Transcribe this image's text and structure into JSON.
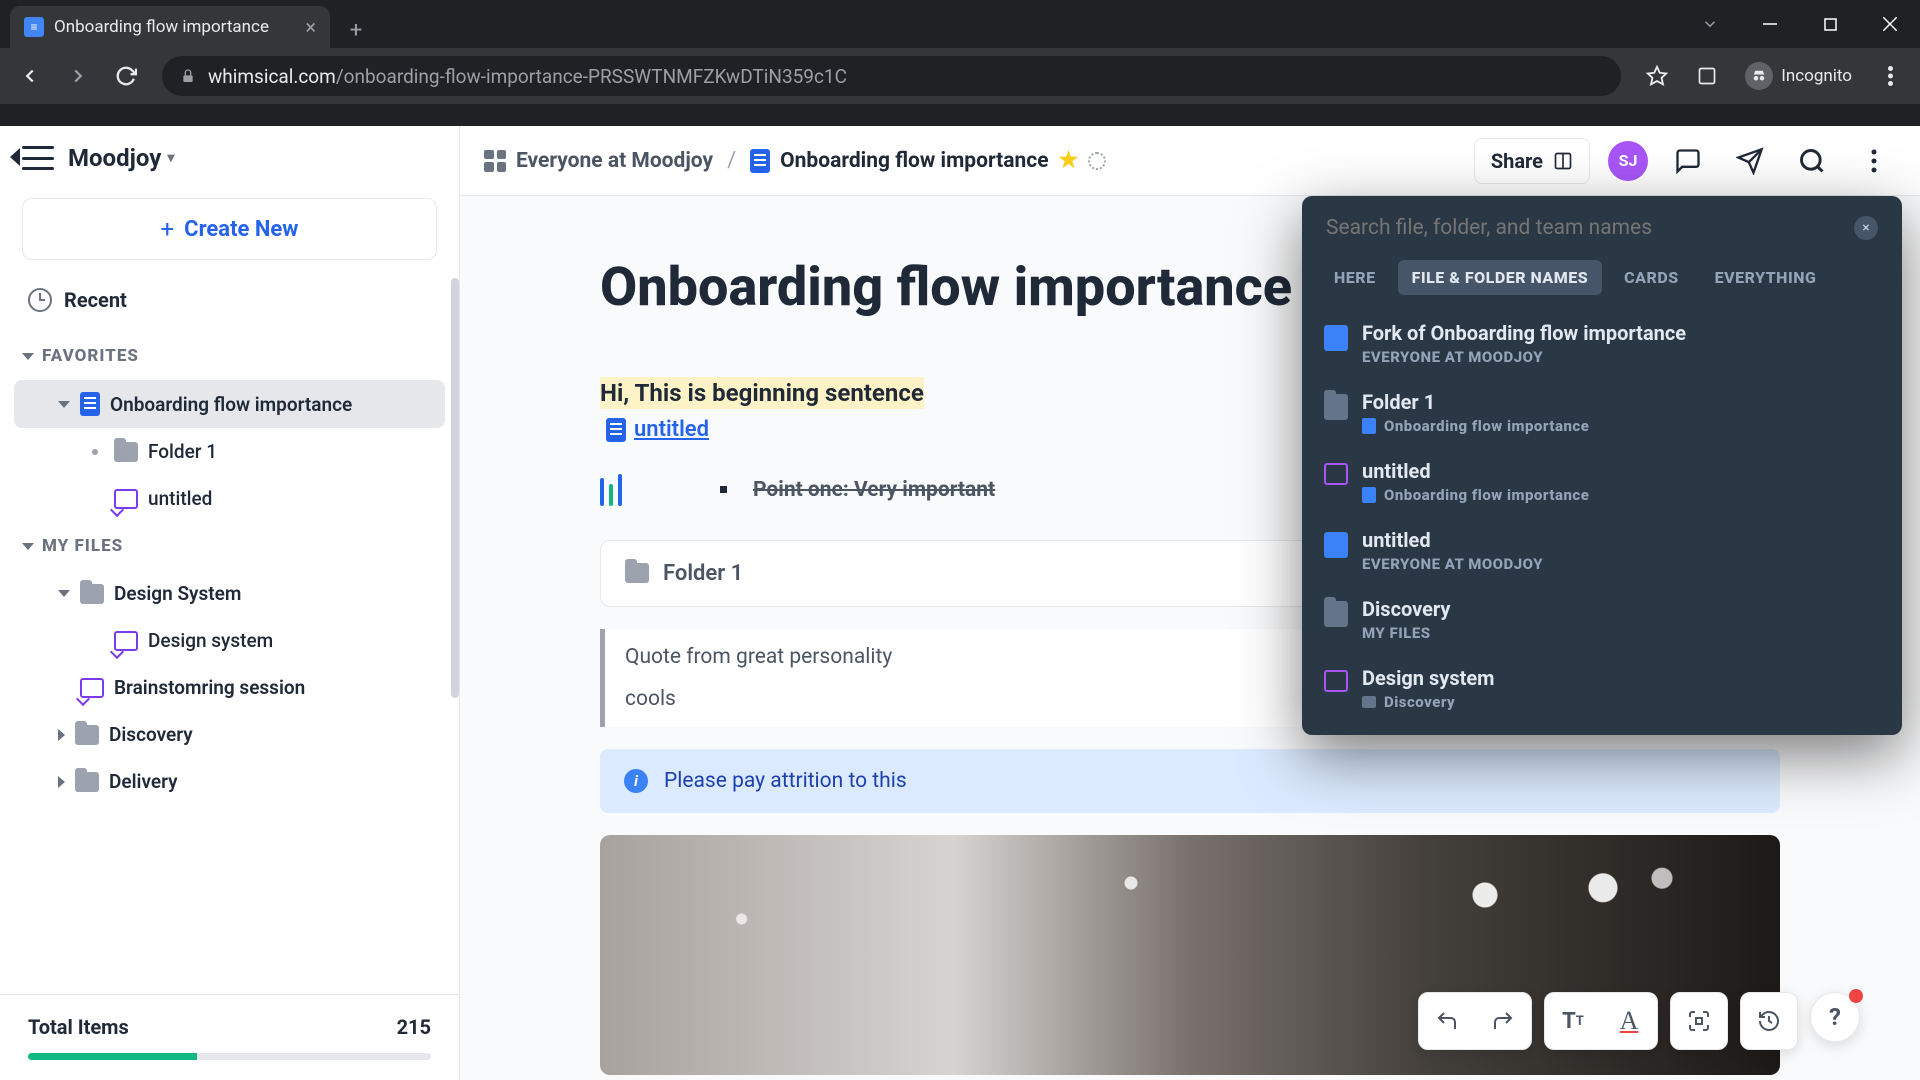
{
  "browser": {
    "tab_title": "Onboarding flow importance",
    "url_domain": "whimsical.com",
    "url_path": "/onboarding-flow-importance-PRSSWTNMFZKwDTiN359c1C",
    "incognito_label": "Incognito"
  },
  "workspace": {
    "name": "Moodjoy"
  },
  "sidebar": {
    "create_label": "Create New",
    "recent_label": "Recent",
    "favorites_label": "FAVORITES",
    "myfiles_label": "MY FILES",
    "fav_items": [
      {
        "label": "Onboarding flow importance"
      },
      {
        "label": "Folder 1"
      },
      {
        "label": "untitled"
      }
    ],
    "my_items": [
      {
        "label": "Design System"
      },
      {
        "label": "Design system"
      },
      {
        "label": "Brainstomring session"
      },
      {
        "label": "Discovery"
      },
      {
        "label": "Delivery"
      }
    ],
    "footer_label": "Total Items",
    "footer_count": "215"
  },
  "topbar": {
    "crumb_workspace": "Everyone at Moodjoy",
    "crumb_doc": "Onboarding flow importance",
    "share_label": "Share",
    "avatar_initials": "SJ"
  },
  "doc": {
    "title": "Onboarding flow importance",
    "highlight": "Hi, This is beginning sentence",
    "linked_doc": "untitled",
    "point_one": "Point one: Very important",
    "folder_label": "Folder 1",
    "quote_line1": "Quote from great personality",
    "quote_line2": "cools",
    "info_text": "Please pay attrition to this"
  },
  "search": {
    "placeholder": "Search file, folder, and team names",
    "filters": [
      "HERE",
      "FILE & FOLDER NAMES",
      "CARDS",
      "EVERYTHING"
    ],
    "results": [
      {
        "type": "doc",
        "title": "Fork of Onboarding flow importance",
        "sub": "EVERYONE AT MOODJOY"
      },
      {
        "type": "fold",
        "title": "Folder 1",
        "sub": "Onboarding flow importance",
        "sub_ico": "doc"
      },
      {
        "type": "brd",
        "title": "untitled",
        "sub": "Onboarding flow importance",
        "sub_ico": "doc"
      },
      {
        "type": "doc",
        "title": "untitled",
        "sub": "EVERYONE AT MOODJOY"
      },
      {
        "type": "fold",
        "title": "Discovery",
        "sub": "MY FILES"
      },
      {
        "type": "brd",
        "title": "Design system",
        "sub": "Discovery",
        "sub_ico": "fold"
      }
    ]
  }
}
